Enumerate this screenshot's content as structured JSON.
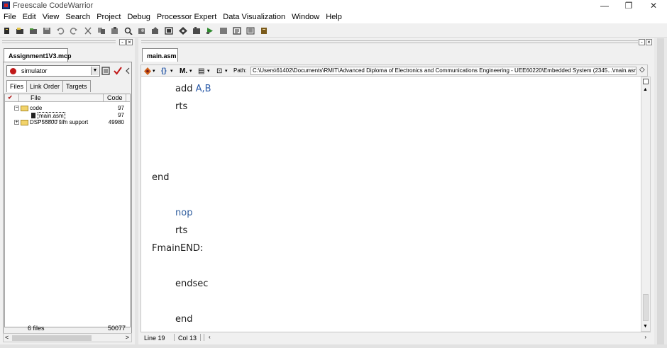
{
  "window": {
    "title": "Freescale CodeWarrior",
    "minimize_glyph": "—",
    "maximize_glyph": "❐",
    "close_glyph": "✕"
  },
  "menu": [
    "File",
    "Edit",
    "View",
    "Search",
    "Project",
    "Debug",
    "Processor Expert",
    "Data Visualization",
    "Window",
    "Help"
  ],
  "toolbar_icons": [
    "new-project-icon",
    "new-file-icon",
    "open-icon",
    "save-icon",
    "undo-icon",
    "redo-icon",
    "cut-icon",
    "copy-icon",
    "paste-icon",
    "find-icon",
    "find-in-files-icon",
    "replace-icon",
    "build-icon",
    "settings-icon",
    "bookmark-icon",
    "debug-icon",
    "run-icon",
    "stop-icon",
    "window-icon",
    "layout-icon",
    "notes-icon"
  ],
  "project": {
    "tab_label": "Assignment1V3.mcp",
    "target": "simulator",
    "subtabs": [
      "Files",
      "Link Order",
      "Targets"
    ],
    "columns": {
      "file": "File",
      "code": "Code"
    },
    "rows": [
      {
        "name": "code",
        "code": "97",
        "expander": "−"
      },
      {
        "name": "main.asm",
        "code": "97"
      },
      {
        "name": "DSP56800 sim support",
        "code": "49980",
        "expander": "+"
      }
    ],
    "footer": {
      "files": "6 files",
      "total": "50077"
    },
    "scroll_left": "<",
    "scroll_right": ">"
  },
  "editor": {
    "tab_label": "main.asm",
    "path_label": "Path:",
    "path": "C:\\Users\\61402\\Documents\\RMIT\\Advanced Diploma of Electronics and Communications Engineering - UEE60220\\Embedded System (2345...\\main.asm",
    "toolbar_glyphs": {
      "functions": "{}",
      "markers": "M.",
      "doc": "▤",
      "lock": "⊡",
      "drop": "▾",
      "diamond": "◇"
    },
    "code": {
      "line1_instr": "add ",
      "line1_operands": "A,B",
      "line2": "rts",
      "line3": "end",
      "line4": "nop",
      "line5": "rts",
      "line6": "FmainEND:",
      "line7": "endsec",
      "line8": "end"
    },
    "status": {
      "line": "Line 19",
      "col": "Col 13"
    },
    "scroll_arrow_left": "‹",
    "scroll_arrow_right": "›"
  },
  "colors": {
    "operand": "#2a5aa8",
    "keyword": "#2f5d9e",
    "accent": "#c01818"
  }
}
